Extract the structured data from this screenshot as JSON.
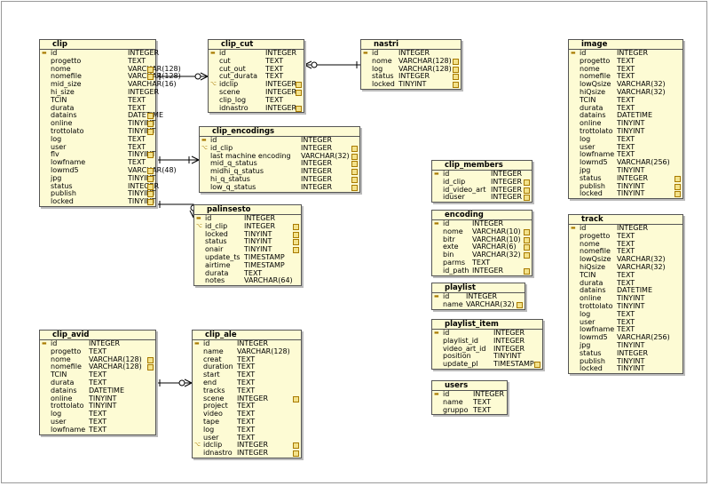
{
  "tables": {
    "clip": {
      "title": "clip",
      "cols": [
        {
          "n": "id",
          "t": "INTEGER",
          "pk": true
        },
        {
          "n": "progetto",
          "t": "TEXT"
        },
        {
          "n": "nome",
          "t": "VARCHAR(128)",
          "fk": true
        },
        {
          "n": "nomefile",
          "t": "VARCHAR(128)",
          "fk": true
        },
        {
          "n": "mid_size",
          "t": "VARCHAR(16)"
        },
        {
          "n": "hi_size",
          "t": "INTEGER"
        },
        {
          "n": "TCIN",
          "t": "TEXT"
        },
        {
          "n": "durata",
          "t": "TEXT"
        },
        {
          "n": "datains",
          "t": "DATETIME",
          "fk": true
        },
        {
          "n": "online",
          "t": "TINYINT",
          "fk": true
        },
        {
          "n": "trottolato",
          "t": "TINYINT",
          "fk": true
        },
        {
          "n": "log",
          "t": "TEXT"
        },
        {
          "n": "user",
          "t": "TEXT"
        },
        {
          "n": "flv",
          "t": "TINYINT",
          "fk": true
        },
        {
          "n": "lowfname",
          "t": "TEXT"
        },
        {
          "n": "lowmd5",
          "t": "VARCHAR(48)",
          "fk": true
        },
        {
          "n": "jpg",
          "t": "TINYINT",
          "fk": true
        },
        {
          "n": "status",
          "t": "INTEGER",
          "fk": true
        },
        {
          "n": "publish",
          "t": "TINYINT",
          "fk": true
        },
        {
          "n": "locked",
          "t": "TINYINT",
          "fk": true
        }
      ]
    },
    "clip_cut": {
      "title": "clip_cut",
      "cols": [
        {
          "n": "id",
          "t": "INTEGER",
          "pk": true
        },
        {
          "n": "cut",
          "t": "TEXT"
        },
        {
          "n": "cut_out",
          "t": "TEXT"
        },
        {
          "n": "cut_durata",
          "t": "TEXT"
        },
        {
          "n": "idclip",
          "t": "INTEGER",
          "fkey": true,
          "fk": true
        },
        {
          "n": "scene",
          "t": "INTEGER",
          "fk": true
        },
        {
          "n": "clip_log",
          "t": "TEXT"
        },
        {
          "n": "idnastro",
          "t": "INTEGER",
          "fk": true
        }
      ]
    },
    "nastri": {
      "title": "nastri",
      "cols": [
        {
          "n": "id",
          "t": "INTEGER",
          "pk": true
        },
        {
          "n": "nome",
          "t": "VARCHAR(128)",
          "fk": true
        },
        {
          "n": "log",
          "t": "VARCHAR(128)",
          "fk": true
        },
        {
          "n": "status",
          "t": "INTEGER",
          "fk": true
        },
        {
          "n": "locked",
          "t": "TINYINT",
          "fk": true
        }
      ]
    },
    "image": {
      "title": "image",
      "cols": [
        {
          "n": "id",
          "t": "INTEGER",
          "pk": true
        },
        {
          "n": "progetto",
          "t": "TEXT"
        },
        {
          "n": "nome",
          "t": "TEXT"
        },
        {
          "n": "nomefile",
          "t": "TEXT"
        },
        {
          "n": "lowQsize",
          "t": "VARCHAR(32)"
        },
        {
          "n": "hiQsize",
          "t": "VARCHAR(32)"
        },
        {
          "n": "TCIN",
          "t": "TEXT"
        },
        {
          "n": "durata",
          "t": "TEXT"
        },
        {
          "n": "datains",
          "t": "DATETIME"
        },
        {
          "n": "online",
          "t": "TINYINT"
        },
        {
          "n": "trottolato",
          "t": "TINYINT"
        },
        {
          "n": "log",
          "t": "TEXT"
        },
        {
          "n": "user",
          "t": "TEXT"
        },
        {
          "n": "lowfname",
          "t": "TEXT"
        },
        {
          "n": "lowmd5",
          "t": "VARCHAR(256)"
        },
        {
          "n": "jpg",
          "t": "TINYINT"
        },
        {
          "n": "status",
          "t": "INTEGER",
          "fk": true
        },
        {
          "n": "publish",
          "t": "TINYINT",
          "fk": true
        },
        {
          "n": "locked",
          "t": "TINYINT",
          "fk": true
        }
      ]
    },
    "clip_encodings": {
      "title": "clip_encodings",
      "cols": [
        {
          "n": "id",
          "t": "INTEGER",
          "pk": true
        },
        {
          "n": "id_clip",
          "t": "INTEGER",
          "fkey": true,
          "fk": true
        },
        {
          "n": "last machine encoding",
          "t": "VARCHAR(32)",
          "fk": true
        },
        {
          "n": "mid_q_status",
          "t": "INTEGER",
          "fk": true
        },
        {
          "n": "midhi_q_status",
          "t": "INTEGER",
          "fk": true
        },
        {
          "n": "hi_q_status",
          "t": "INTEGER",
          "fk": true
        },
        {
          "n": "low_q_status",
          "t": "INTEGER",
          "fk": true
        }
      ]
    },
    "palinsesto": {
      "title": "palinsesto",
      "cols": [
        {
          "n": "id",
          "t": "INTEGER",
          "pk": true
        },
        {
          "n": "id_clip",
          "t": "INTEGER",
          "fkey": true,
          "fk": true
        },
        {
          "n": "locked",
          "t": "TINYINT",
          "fk": true
        },
        {
          "n": "status",
          "t": "TINYINT",
          "fk": true
        },
        {
          "n": "onair",
          "t": "TINYINT",
          "fk": true
        },
        {
          "n": "update_ts",
          "t": "TIMESTAMP"
        },
        {
          "n": "airtime",
          "t": "TIMESTAMP"
        },
        {
          "n": "durata",
          "t": "TEXT"
        },
        {
          "n": "notes",
          "t": "VARCHAR(64)"
        }
      ]
    },
    "clip_members": {
      "title": "clip_members",
      "cols": [
        {
          "n": "id",
          "t": "INTEGER",
          "pk": true
        },
        {
          "n": "id_clip",
          "t": "INTEGER",
          "fk": true
        },
        {
          "n": "id_video_art",
          "t": "INTEGER",
          "fk": true
        },
        {
          "n": "iduser",
          "t": "INTEGER",
          "fk": true
        }
      ]
    },
    "encoding": {
      "title": "encoding",
      "cols": [
        {
          "n": "id",
          "t": "INTEGER",
          "pk": true
        },
        {
          "n": "nome",
          "t": "VARCHAR(10)",
          "fk": true
        },
        {
          "n": "bitr",
          "t": "VARCHAR(10)",
          "fk": true
        },
        {
          "n": "exte",
          "t": "VARCHAR(6)",
          "fk": true
        },
        {
          "n": "bin",
          "t": "VARCHAR(32)",
          "fk": true
        },
        {
          "n": "parms",
          "t": "TEXT"
        },
        {
          "n": "id_path",
          "t": "INTEGER",
          "fk": true
        }
      ]
    },
    "playlist": {
      "title": "playlist",
      "cols": [
        {
          "n": "id",
          "t": "INTEGER",
          "pk": true
        },
        {
          "n": "name",
          "t": "VARCHAR(32)",
          "fk": true
        }
      ]
    },
    "playlist_item": {
      "title": "playlist_item",
      "cols": [
        {
          "n": "id",
          "t": "INTEGER",
          "pk": true
        },
        {
          "n": "playlist_id",
          "t": "INTEGER"
        },
        {
          "n": "video_art_id",
          "t": "INTEGER"
        },
        {
          "n": "position",
          "t": "TINYINT"
        },
        {
          "n": "update_pl",
          "t": "TIMESTAMP",
          "fk": true
        }
      ]
    },
    "users": {
      "title": "users",
      "cols": [
        {
          "n": "id",
          "t": "INTEGER",
          "pk": true
        },
        {
          "n": "name",
          "t": "TEXT"
        },
        {
          "n": "gruppo",
          "t": "TEXT"
        }
      ]
    },
    "track": {
      "title": "track",
      "cols": [
        {
          "n": "id",
          "t": "INTEGER",
          "pk": true
        },
        {
          "n": "progetto",
          "t": "TEXT"
        },
        {
          "n": "nome",
          "t": "TEXT"
        },
        {
          "n": "nomefile",
          "t": "TEXT"
        },
        {
          "n": "lowQsize",
          "t": "VARCHAR(32)"
        },
        {
          "n": "hiQsize",
          "t": "VARCHAR(32)"
        },
        {
          "n": "TCIN",
          "t": "TEXT"
        },
        {
          "n": "durata",
          "t": "TEXT"
        },
        {
          "n": "datains",
          "t": "DATETIME"
        },
        {
          "n": "online",
          "t": "TINYINT"
        },
        {
          "n": "trottolato",
          "t": "TINYINT"
        },
        {
          "n": "log",
          "t": "TEXT"
        },
        {
          "n": "user",
          "t": "TEXT"
        },
        {
          "n": "lowfname",
          "t": "TEXT"
        },
        {
          "n": "lowmd5",
          "t": "VARCHAR(256)"
        },
        {
          "n": "jpg",
          "t": "TINYINT"
        },
        {
          "n": "status",
          "t": "INTEGER"
        },
        {
          "n": "publish",
          "t": "TINYINT"
        },
        {
          "n": "locked",
          "t": "TINYINT"
        }
      ]
    },
    "clip_avid": {
      "title": "clip_avid",
      "cols": [
        {
          "n": "id",
          "t": "INTEGER",
          "pk": true
        },
        {
          "n": "progetto",
          "t": "TEXT"
        },
        {
          "n": "nome",
          "t": "VARCHAR(128)",
          "fk": true
        },
        {
          "n": "nomefile",
          "t": "VARCHAR(128)",
          "fk": true
        },
        {
          "n": "TCIN",
          "t": "TEXT"
        },
        {
          "n": "durata",
          "t": "TEXT"
        },
        {
          "n": "datains",
          "t": "DATETIME"
        },
        {
          "n": "online",
          "t": "TINYINT"
        },
        {
          "n": "trottolato",
          "t": "TINYINT"
        },
        {
          "n": "log",
          "t": "TEXT"
        },
        {
          "n": "user",
          "t": "TEXT"
        },
        {
          "n": "lowfname",
          "t": "TEXT"
        }
      ]
    },
    "clip_ale": {
      "title": "clip_ale",
      "cols": [
        {
          "n": "id",
          "t": "INTEGER",
          "pk": true
        },
        {
          "n": "name",
          "t": "VARCHAR(128)"
        },
        {
          "n": "creat",
          "t": "TEXT"
        },
        {
          "n": "duration",
          "t": "TEXT"
        },
        {
          "n": "start",
          "t": "TEXT"
        },
        {
          "n": "end",
          "t": "TEXT"
        },
        {
          "n": "tracks",
          "t": "TEXT"
        },
        {
          "n": "scene",
          "t": "INTEGER",
          "fk": true
        },
        {
          "n": "project",
          "t": "TEXT"
        },
        {
          "n": "video",
          "t": "TEXT"
        },
        {
          "n": "tape",
          "t": "TEXT"
        },
        {
          "n": "log",
          "t": "TEXT"
        },
        {
          "n": "user",
          "t": "TEXT"
        },
        {
          "n": "idclip",
          "t": "INTEGER",
          "fkey": true,
          "fk": true
        },
        {
          "n": "idnastro",
          "t": "INTEGER",
          "fk": true
        }
      ]
    }
  }
}
